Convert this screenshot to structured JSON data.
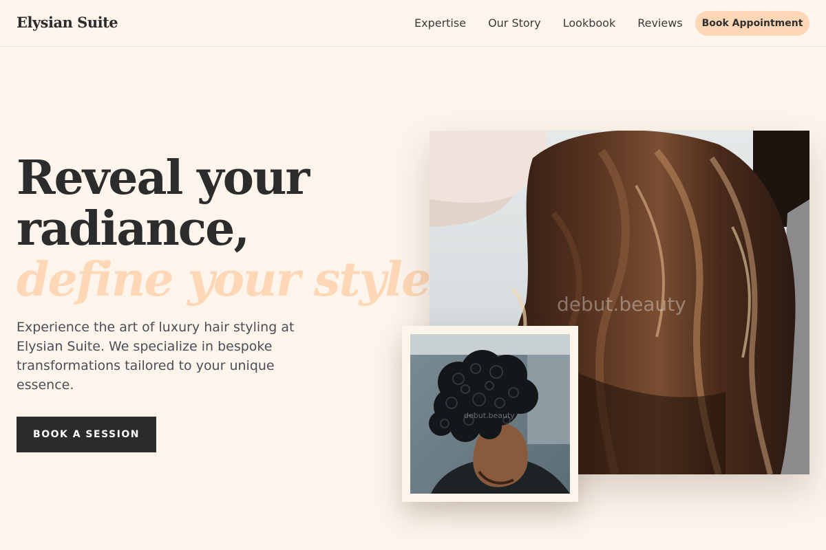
{
  "header": {
    "brand": "Elysian Suite",
    "nav": [
      {
        "label": "Expertise"
      },
      {
        "label": "Our Story"
      },
      {
        "label": "Lookbook"
      },
      {
        "label": "Reviews"
      }
    ],
    "cta_label": "Book Appointment"
  },
  "hero": {
    "headline_line1": "Reveal your",
    "headline_line2": "radiance,",
    "headline_accent": "define your style.",
    "lead": "Experience the art of luxury hair styling at Elysian Suite. We specialize in bespoke transformations tailored to your unique essence.",
    "cta_label": "BOOK A SESSION"
  },
  "images": {
    "large_photo_icon": "long-brown-hair-photo",
    "small_photo_icon": "curly-hair-man-photo",
    "large_watermark": "debut.beauty",
    "small_watermark": "debut.beauty"
  },
  "colors": {
    "background": "#fdf4ec",
    "accent": "#fdd7b6",
    "dark": "#2b2b2b"
  }
}
